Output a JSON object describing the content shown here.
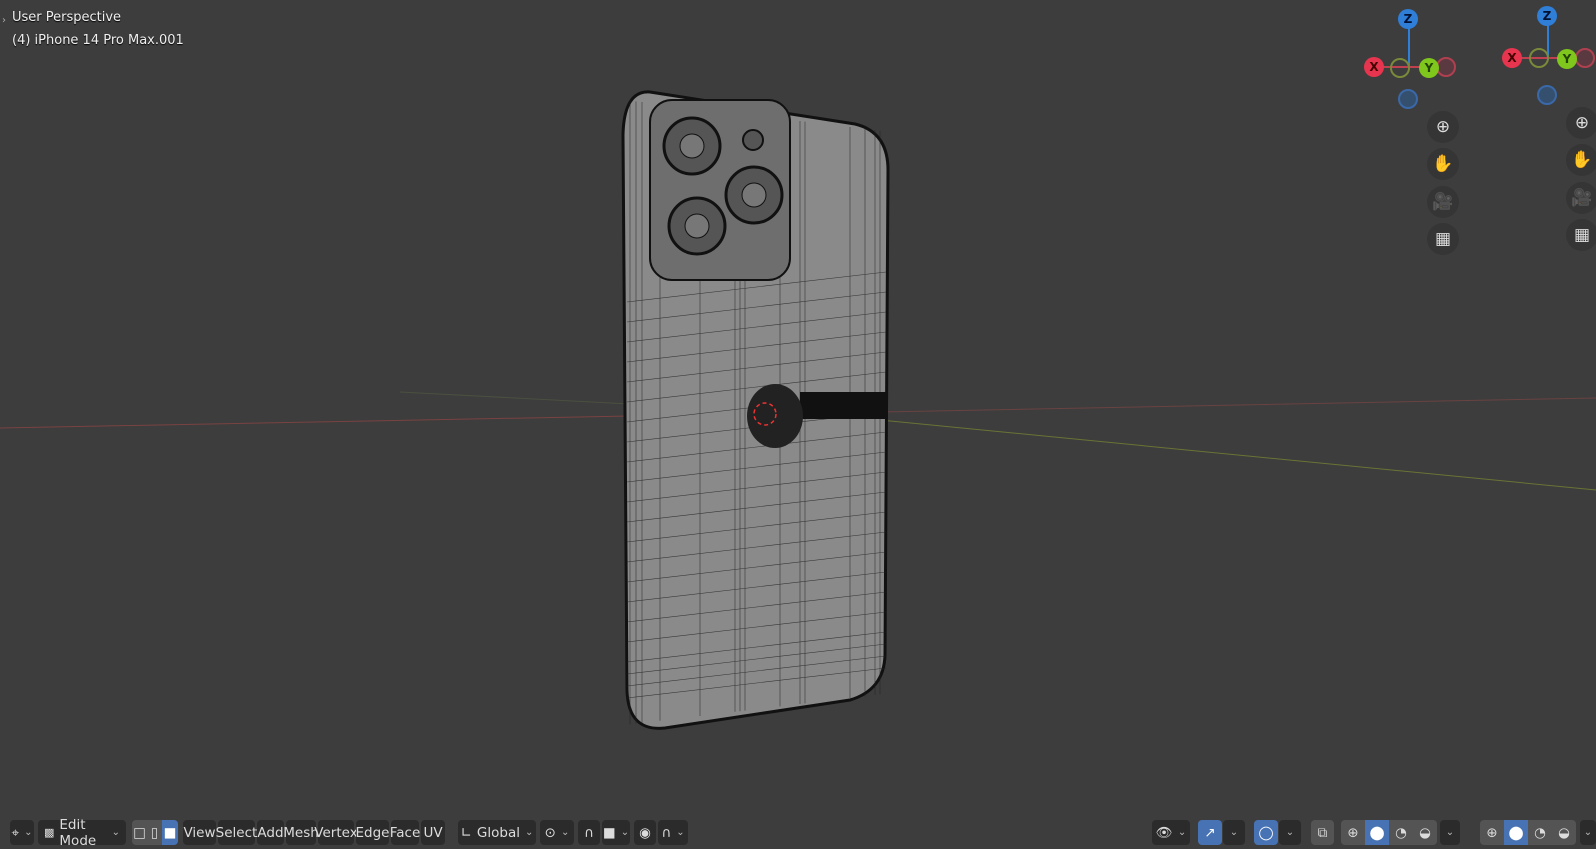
{
  "viewport": {
    "perspective_label": "User Perspective",
    "object_label": "(4) iPhone 14 Pro Max.001"
  },
  "gizmo": {
    "axes": [
      "X",
      "Y",
      "Z"
    ],
    "colors": {
      "x": "#e8354f",
      "y": "#7fc61d",
      "z": "#2f7fd8"
    }
  },
  "nav_buttons": [
    {
      "icon": "zoom-icon"
    },
    {
      "icon": "hand-pan-icon"
    },
    {
      "icon": "camera-icon"
    },
    {
      "icon": "perspective-grid-icon"
    }
  ],
  "toolbar": {
    "mode": "Edit Mode",
    "menus": [
      "View",
      "Select",
      "Add",
      "Mesh",
      "Vertex",
      "Edge",
      "Face",
      "UV"
    ],
    "select_modes": [
      "vertex",
      "edge",
      "face"
    ],
    "active_select_mode": "face",
    "orientation": "Global",
    "shading_modes": [
      "wireframe",
      "solid",
      "material",
      "rendered"
    ],
    "active_shading": "solid"
  },
  "accent": "#4772b3"
}
